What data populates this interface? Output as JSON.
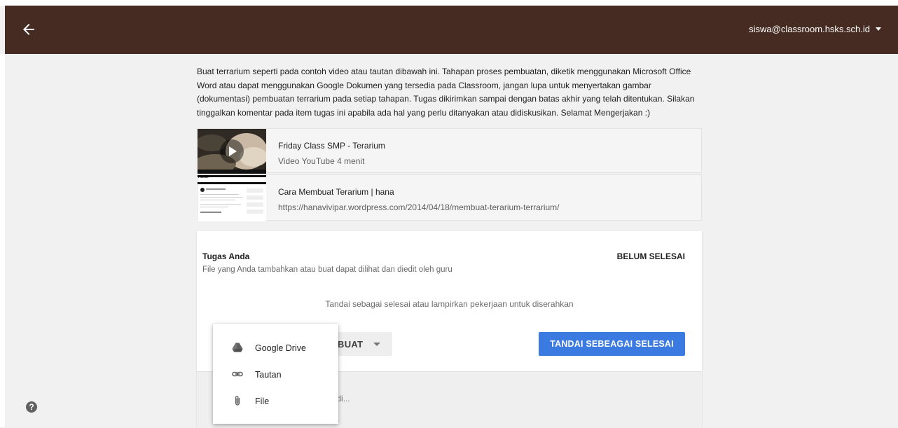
{
  "header": {
    "account": "siswa@classroom.hsks.sch.id"
  },
  "description": "Buat terrarium seperti pada contoh video atau tautan dibawah ini. Tahapan proses pembuatan, diketik menggunakan Microsoft Office Word atau dapat menggunakan Google Dokumen yang tersedia pada Classroom, jangan lupa untuk menyertakan gambar (dokumentasi) pembuatan terrarium pada setiap tahapan. Tugas dikirimkan sampai dengan batas akhir yang telah ditentukan. Silakan tinggalkan komentar pada item tugas ini apabila ada hal yang perlu ditanyakan atau didiskusikan. Selamat Mengerjakan :)",
  "materials": [
    {
      "title": "Friday Class SMP - Terarium",
      "subtitle": "Video YouTube   4 menit",
      "icon": "play-icon"
    },
    {
      "title": "Cara Membuat Terarium | hana",
      "subtitle": "https://hanavivipar.wordpress.com/2014/04/18/membuat-terarium-terrarium/",
      "thumb_text": "HANA"
    }
  ],
  "work": {
    "title": "Tugas Anda",
    "status": "BELUM SELESAI",
    "subtitle": "File yang Anda tambahkan atau buat dapat dilihat dan diedit oleh guru",
    "hint": "Tandai sebagai selesai atau lampirkan pekerjaan untuk diserahkan",
    "add_button_partial": "BUAT",
    "mark_button": "TANDAI SEBEAGAI SELESAI",
    "comment_partial": "badi..."
  },
  "dropdown": {
    "items": [
      {
        "label": "Google Drive",
        "icon": "google-drive-icon"
      },
      {
        "label": "Tautan",
        "icon": "link-icon"
      },
      {
        "label": "File",
        "icon": "paperclip-icon"
      }
    ]
  },
  "help": {
    "icon": "help-icon",
    "glyph": "?"
  },
  "colors": {
    "appbar": "#462b22",
    "primary_button": "#3b7ae0",
    "background": "#f1f1f1"
  }
}
